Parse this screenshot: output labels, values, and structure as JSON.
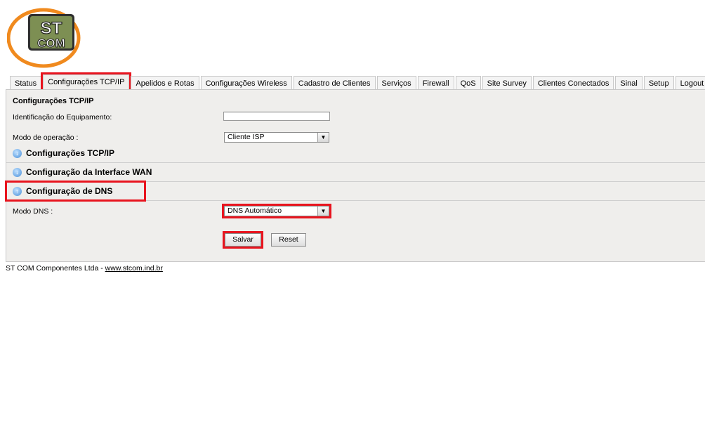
{
  "logo": {
    "line1": "ST",
    "line2": "COM"
  },
  "tabs": [
    "Status",
    "Configurações TCP/IP",
    "Apelidos e Rotas",
    "Configurações Wireless",
    "Cadastro de Clientes",
    "Serviços",
    "Firewall",
    "QoS",
    "Site Survey",
    "Clientes Conectados",
    "Sinal",
    "Setup",
    "Logout"
  ],
  "panel": {
    "title": "Configurações TCP/IP",
    "device_id_label": "Identificação do Equipamento:",
    "device_id_value": "",
    "mode_label": "Modo de operação :",
    "mode_value": "Cliente ISP",
    "sections": {
      "tcpip": "Configurações TCP/IP",
      "wan": "Configuração da Interface WAN",
      "dns": "Configuração de DNS"
    },
    "dns_mode_label": "Modo DNS :",
    "dns_mode_value": "DNS Automático",
    "save_label": "Salvar",
    "reset_label": "Reset"
  },
  "footer": {
    "company": "ST COM Componentes Ltda - ",
    "link": "www.stcom.ind.br"
  },
  "colors": {
    "highlight": "#e8141e",
    "logo_orange": "#f08a1e",
    "logo_green": "#6d7f45"
  }
}
